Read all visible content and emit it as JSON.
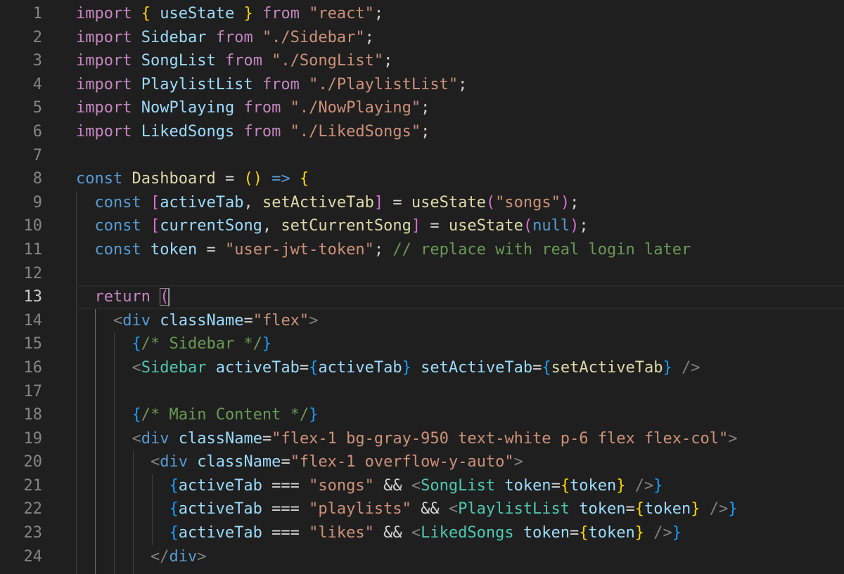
{
  "editor": {
    "active_line": 13,
    "line_numbers": [
      "1",
      "2",
      "3",
      "4",
      "5",
      "6",
      "7",
      "8",
      "9",
      "10",
      "11",
      "12",
      "13",
      "14",
      "15",
      "16",
      "17",
      "18",
      "19",
      "20",
      "21",
      "22",
      "23",
      "24"
    ],
    "tokens": {
      "t_import": "import",
      "t_from": "from",
      "t_const": "const",
      "t_return": "return",
      "t_semi": ";",
      "t_eq": " = ",
      "t_comma": ", ",
      "t_lbrace": "{",
      "t_rbrace": "}",
      "t_lbracket": "[",
      "t_rbracket": "]",
      "t_lparen": "(",
      "t_rparen": ")",
      "t_arrow": "=>",
      "t_lt": "<",
      "t_gt": ">",
      "t_selfclose": " />",
      "t_lt_slash": "</",
      "t_triple_eq": " === ",
      "t_and": " && ",
      "t_attr_eq": "=",
      "useState": "useState",
      "Sidebar": "Sidebar",
      "SongList": "SongList",
      "PlaylistList": "PlaylistList",
      "NowPlaying": "NowPlaying",
      "LikedSongs": "LikedSongs",
      "Dashboard": "Dashboard",
      "activeTab": "activeTab",
      "setActiveTab": "setActiveTab",
      "currentSong": "currentSong",
      "setCurrentSong": "setCurrentSong",
      "token": "token",
      "null": "null",
      "div": "div",
      "className": "className",
      "s_react": "\"react\"",
      "s_sidebar": "\"./Sidebar\"",
      "s_songlist": "\"./SongList\"",
      "s_playlistlist": "\"./PlaylistList\"",
      "s_nowplaying": "\"./NowPlaying\"",
      "s_likedsongs": "\"./LikedSongs\"",
      "s_songs": "\"songs\"",
      "s_token": "\"user-jwt-token\"",
      "s_flex": "\"flex\"",
      "s_main_class": "\"flex-1 bg-gray-950 text-white p-6 flex flex-col\"",
      "s_overflow_class": "\"flex-1 overflow-y-auto\"",
      "s_playlists": "\"playlists\"",
      "s_likes": "\"likes\"",
      "c_replace": "// replace with real login later",
      "c_sidebar": "/* Sidebar */",
      "c_main": "/* Main Content */"
    }
  }
}
